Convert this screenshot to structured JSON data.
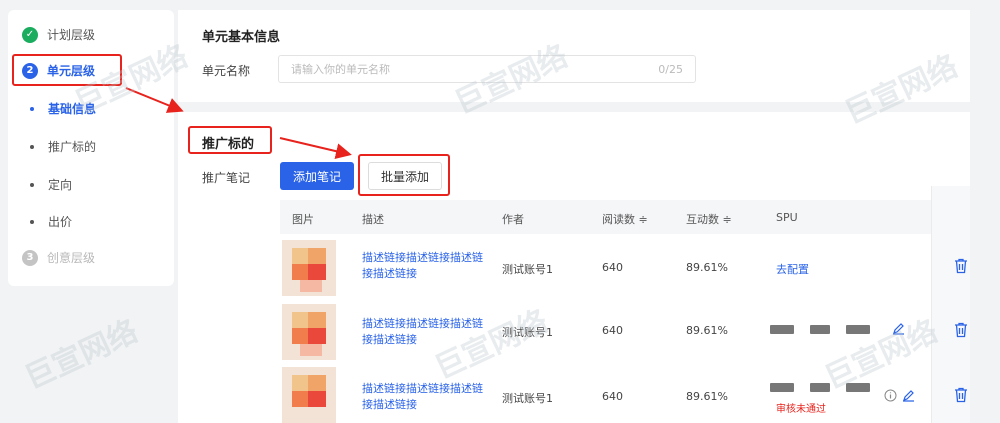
{
  "sidebar": {
    "items": [
      {
        "label": "计划层级",
        "badge": "✓"
      },
      {
        "label": "单元层级",
        "badge": "2"
      },
      {
        "label": "基础信息"
      },
      {
        "label": "推广标的"
      },
      {
        "label": "定向"
      },
      {
        "label": "出价"
      },
      {
        "label": "创意层级",
        "badge": "3"
      }
    ]
  },
  "basic": {
    "title": "单元基本信息",
    "name_label": "单元名称",
    "name_placeholder": "请输入你的单元名称",
    "name_counter": "0/25"
  },
  "promo": {
    "title": "推广标的",
    "notes_label": "推广笔记",
    "add_button": "添加笔记",
    "batch_button": "批量添加"
  },
  "table": {
    "headers": [
      "图片",
      "描述",
      "作者",
      "阅读数 ≑",
      "互动数 ≑",
      "SPU"
    ],
    "rows": [
      {
        "desc": "描述链接描述链接描述链接描述链接",
        "author": "测试账号1",
        "reads": "640",
        "interact": "89.61%",
        "spu": "去配置",
        "status": ""
      },
      {
        "desc": "描述链接描述链接描述链接描述链接",
        "author": "测试账号1",
        "reads": "640",
        "interact": "89.61%",
        "spu": "",
        "status": ""
      },
      {
        "desc": "描述链接描述链接描述链接描述链接",
        "author": "测试账号1",
        "reads": "640",
        "interact": "89.61%",
        "spu": "",
        "status": "审核未通过"
      }
    ]
  },
  "watermark": "巨宣网络",
  "colors": {
    "accent": "#2a63e8",
    "annotation": "#e8221c",
    "success": "#1aad5f"
  }
}
